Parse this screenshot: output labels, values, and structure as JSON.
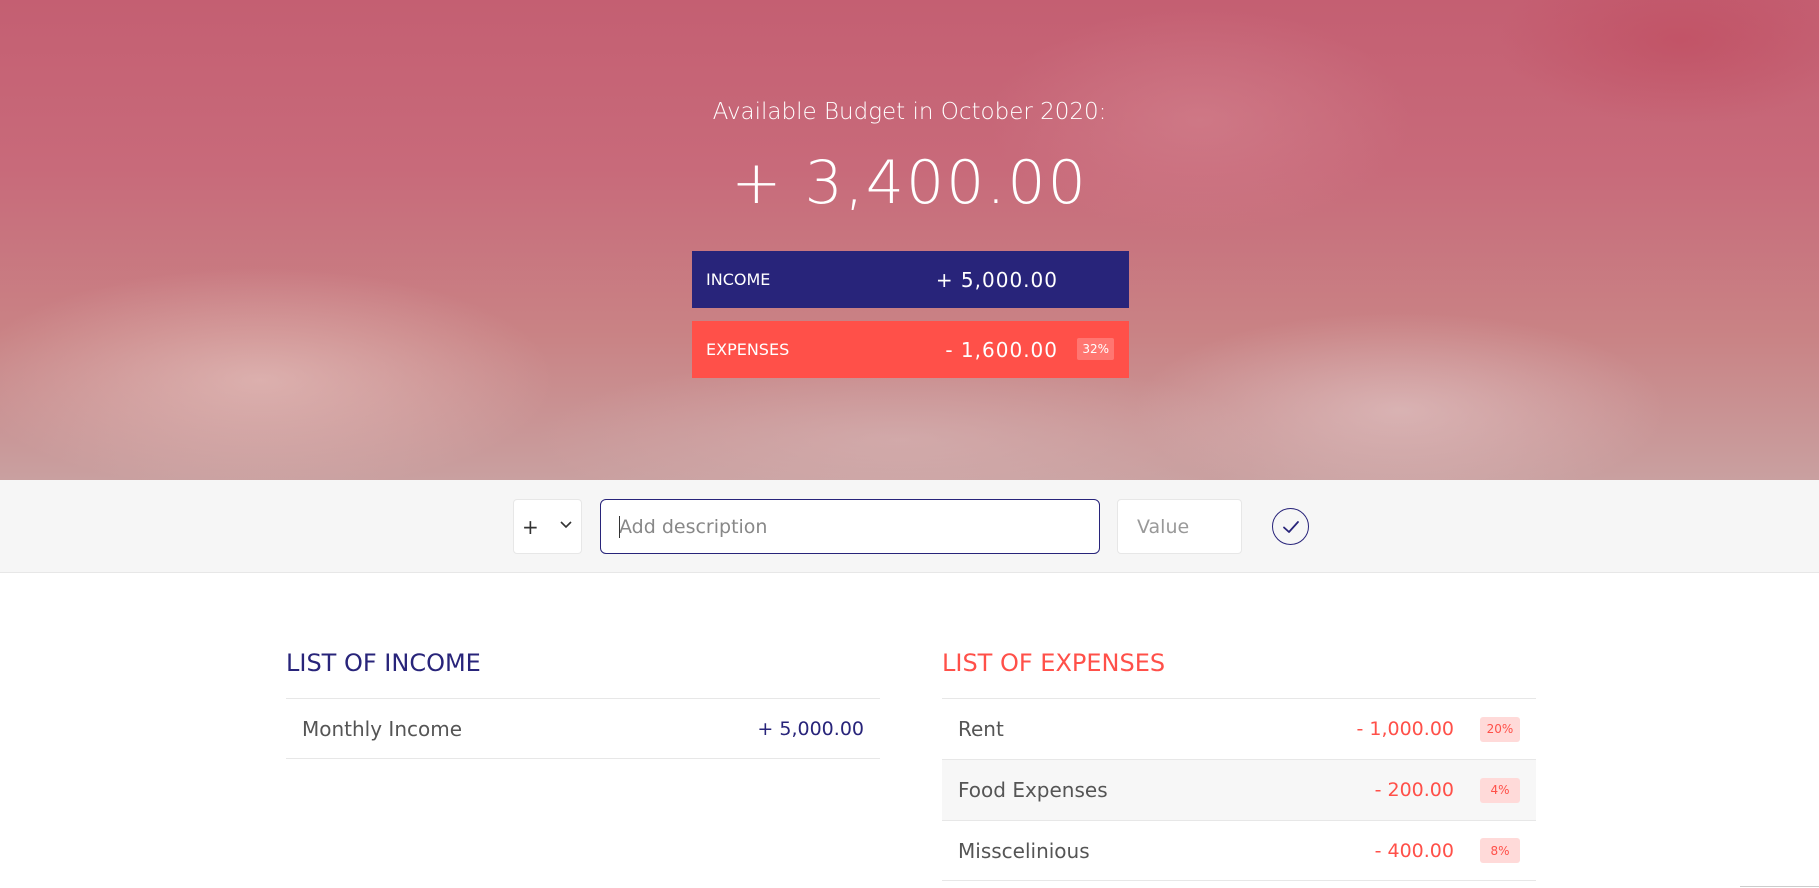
{
  "header": {
    "budget_title": "Available Budget in October 2020:",
    "budget_value": "+ 3,400.00",
    "income": {
      "label": "Income",
      "value": "+ 5,000.00"
    },
    "expenses": {
      "label": "Expenses",
      "value": "- 1,600.00",
      "percentage": "32%"
    }
  },
  "add_bar": {
    "type_value": "+",
    "description_placeholder": "Add description",
    "value_placeholder": "Value",
    "submit_icon": "check-circle-icon"
  },
  "income_list": {
    "title": "List of Income",
    "items": [
      {
        "description": "Monthly Income",
        "value": "+ 5,000.00"
      }
    ]
  },
  "expenses_list": {
    "title": "List of Expenses",
    "items": [
      {
        "description": "Rent",
        "value": "- 1,000.00",
        "percentage": "20%"
      },
      {
        "description": "Food Expenses",
        "value": "- 200.00",
        "percentage": "4%"
      },
      {
        "description": "Misscelinious",
        "value": "- 400.00",
        "percentage": "8%"
      }
    ]
  },
  "colors": {
    "income": "#28247a",
    "expenses": "#ff5049"
  }
}
